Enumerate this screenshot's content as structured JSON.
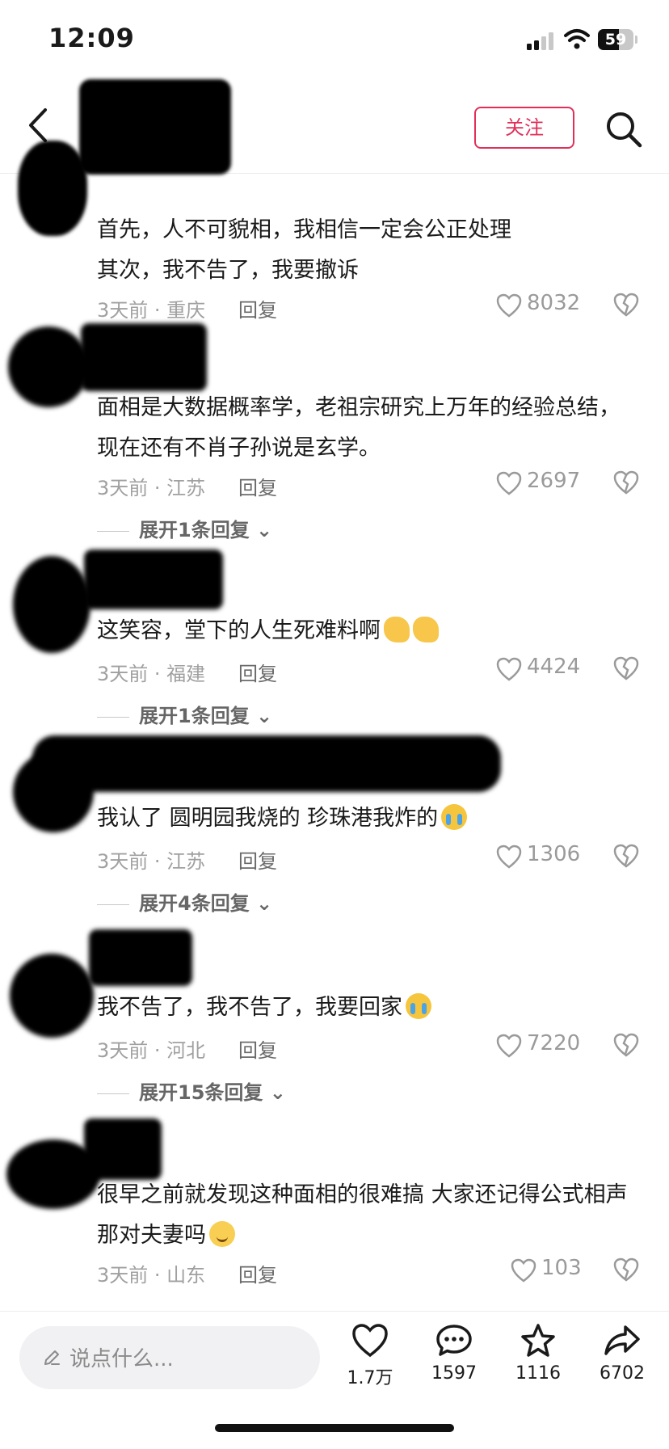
{
  "status_bar": {
    "time": "12:09",
    "battery": "59",
    "battery_level": 0.59
  },
  "header": {
    "follow_label": "关注"
  },
  "comments": [
    {
      "text": "首先，人不可貌相，我相信一定会公正处理\n其次，我不告了，我要撤诉",
      "meta": "3天前 · 重庆",
      "reply": "回复",
      "likes": "8032"
    },
    {
      "text": "面相是大数据概率学，老祖宗研究上万年的经验总结，现在还有不肖子孙说是玄学。",
      "meta": "3天前 · 江苏",
      "reply": "回复",
      "likes": "2697",
      "expand": "展开1条回复"
    },
    {
      "text": "这笑容，堂下的人生死难料啊",
      "meta": "3天前 · 福建",
      "reply": "回复",
      "likes": "4424",
      "expand": "展开1条回复"
    },
    {
      "text": "我认了  圆明园我烧的  珍珠港我炸的",
      "meta": "3天前 · 江苏",
      "reply": "回复",
      "likes": "1306",
      "expand": "展开4条回复"
    },
    {
      "text": "我不告了，我不告了，我要回家",
      "meta": "3天前 · 河北",
      "reply": "回复",
      "likes": "7220",
      "expand": "展开15条回复"
    },
    {
      "text": "很早之前就发现这种面相的很难搞 大家还记得公式相声那对夫妻吗",
      "meta": "3天前 · 山东",
      "reply": "回复",
      "likes": "103"
    }
  ],
  "bottom_bar": {
    "input_placeholder": "说点什么...",
    "like_count": "1.7万",
    "comment_count": "1597",
    "favorite_count": "1116",
    "share_count": "6702"
  },
  "colors": {
    "accent": "#e0305a",
    "meta": "#a0a0a0"
  }
}
